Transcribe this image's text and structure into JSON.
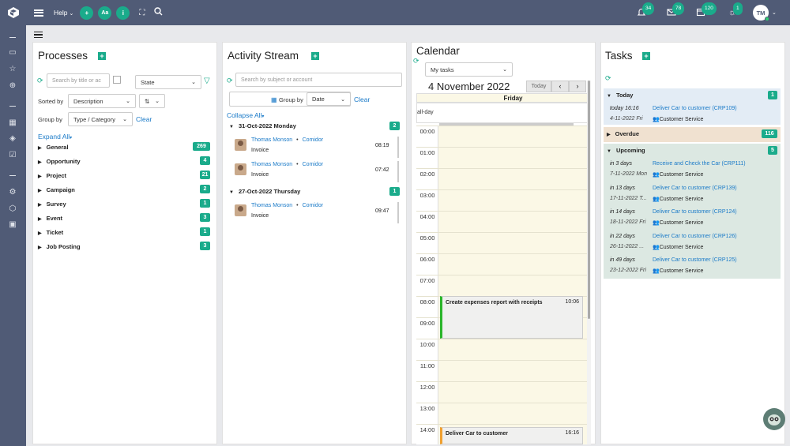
{
  "topbar": {
    "help_label": "Help",
    "add_label": "+",
    "font_label": "Aa",
    "info_label": "i",
    "notifications_count": "34",
    "messages_count": "78",
    "calendar_count": "120",
    "sun_count": "1",
    "avatar_initials": "TM"
  },
  "processes": {
    "title": "Processes",
    "search_placeholder": "Search by title or ac",
    "state_label": "State",
    "sorted_by_label": "Sorted by",
    "sorted_by_value": "Description",
    "group_by_label": "Group by",
    "group_by_value": "Type / Category",
    "clear_label": "Clear",
    "expand_all_label": "Expand All",
    "groups": [
      {
        "name": "General",
        "count": "269"
      },
      {
        "name": "Opportunity",
        "count": "4"
      },
      {
        "name": "Project",
        "count": "21"
      },
      {
        "name": "Campaign",
        "count": "2"
      },
      {
        "name": "Survey",
        "count": "1"
      },
      {
        "name": "Event",
        "count": "3"
      },
      {
        "name": "Ticket",
        "count": "1"
      },
      {
        "name": "Job Posting",
        "count": "3"
      }
    ]
  },
  "activity": {
    "title": "Activity Stream",
    "search_placeholder": "Search by subject or account",
    "group_by_label": "Group by",
    "group_by_value": "Date",
    "clear_label": "Clear",
    "collapse_all_label": "Collapse All",
    "days": [
      {
        "label": "31-Oct-2022 Monday",
        "count": "2",
        "items": [
          {
            "person": "Thomas Monson",
            "company": "Comidor",
            "type": "Invoice",
            "time": "08:19"
          },
          {
            "person": "Thomas Monson",
            "company": "Comidor",
            "type": "Invoice",
            "time": "07:42"
          }
        ]
      },
      {
        "label": "27-Oct-2022 Thursday",
        "count": "1",
        "items": [
          {
            "person": "Thomas Monson",
            "company": "Comidor",
            "type": "Invoice",
            "time": "09:47"
          }
        ]
      }
    ],
    "separator": "•"
  },
  "calendar": {
    "title": "Calendar",
    "filter_value": "My tasks",
    "date_title": "4 November 2022",
    "today_label": "Today",
    "day_name": "Friday",
    "allday_label": "all-day",
    "hours": [
      "00:00",
      "01:00",
      "02:00",
      "03:00",
      "04:00",
      "05:00",
      "06:00",
      "07:00",
      "08:00",
      "09:00",
      "10:00",
      "11:00",
      "12:00",
      "13:00",
      "14:00"
    ],
    "events": [
      {
        "title": "Create expenses report with receipts",
        "time": "10:06",
        "color": "#2ab52a"
      },
      {
        "title": "Deliver Car to customer",
        "time": "16:16",
        "color": "#f0a030"
      }
    ]
  },
  "tasks": {
    "title": "Tasks",
    "sections": [
      {
        "label": "Today",
        "count": "1",
        "bg": "#e3ecf5",
        "items": [
          {
            "when": "today 16:16",
            "date": "4-11-2022 Fri",
            "title": "Deliver Car to customer (CRP109)",
            "group": "Customer Service"
          }
        ]
      },
      {
        "label": "Overdue",
        "count": "116",
        "bg": "#f0e1d0",
        "items": []
      },
      {
        "label": "Upcoming",
        "count": "5",
        "bg": "#dce8e2",
        "items": [
          {
            "when": "in 3 days",
            "date": "7-11-2022 Mon",
            "title": "Receive and Check the Car (CRP111)",
            "group": "Customer Service"
          },
          {
            "when": "in 13 days",
            "date": "17-11-2022 T...",
            "title": "Deliver Car to customer (CRP139)",
            "group": "Customer Service"
          },
          {
            "when": "in 14 days",
            "date": "18-11-2022 Fri",
            "title": "Deliver Car to customer (CRP124)",
            "group": "Customer Service"
          },
          {
            "when": "in 22 days",
            "date": "26-11-2022 ...",
            "title": "Deliver Car to customer (CRP126)",
            "group": "Customer Service"
          },
          {
            "when": "in 49 days",
            "date": "23-12-2022 Fri",
            "title": "Deliver Car to customer (CRP125)",
            "group": "Customer Service"
          }
        ]
      }
    ]
  },
  "colors": {
    "accent": "#1aab8b",
    "topbar": "#505b76",
    "link": "#1a7ac8"
  }
}
